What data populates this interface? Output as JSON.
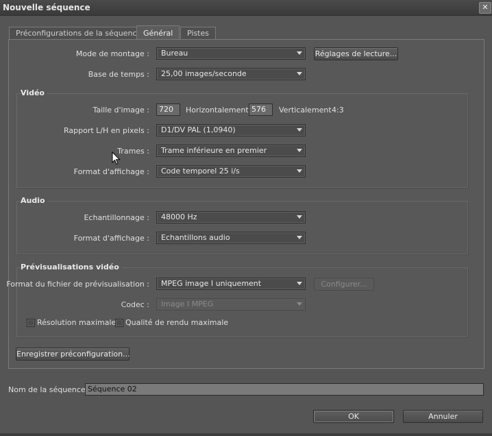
{
  "window": {
    "title": "Nouvelle séquence",
    "close_glyph": "✕"
  },
  "tabs": [
    {
      "label": "Préconfigurations de la séquence"
    },
    {
      "label": "Général"
    },
    {
      "label": "Pistes"
    }
  ],
  "general": {
    "mode_label": "Mode de montage :",
    "mode_value": "Bureau",
    "playback_button": "Réglages de lecture...",
    "timebase_label": "Base de temps :",
    "timebase_value": "25,00 images/seconde"
  },
  "video": {
    "title": "Vidéo",
    "frame_size_label": "Taille d'image :",
    "width": "720",
    "horizontal_label": "Horizontalement",
    "height": "576",
    "vertical_label": "Verticalement",
    "aspect": "4:3",
    "pixel_aspect_label": "Rapport L/H en pixels :",
    "pixel_aspect_value": "D1/DV PAL (1,0940)",
    "fields_label": "Trames :",
    "fields_value": "Trame inférieure en premier",
    "display_format_label": "Format d'affichage :",
    "display_format_value": "Code temporel 25 i/s"
  },
  "audio": {
    "title": "Audio",
    "sample_rate_label": "Echantillonnage :",
    "sample_rate_value": "48000 Hz",
    "display_format_label": "Format d'affichage :",
    "display_format_value": "Echantillons audio"
  },
  "previews": {
    "title": "Prévisualisations vidéo",
    "file_format_label": "Format du fichier de prévisualisation :",
    "file_format_value": "MPEG image I uniquement",
    "configure_button": "Configurer...",
    "codec_label": "Codec :",
    "codec_value": "Image I MPEG",
    "max_resolution_label": "Résolution maximale",
    "max_quality_label": "Qualité de rendu maximale"
  },
  "save_preset_button": "Enregistrer préconfiguration...",
  "sequence_name_label": "Nom de la séquence :",
  "sequence_name_value": "Séquence 02",
  "ok_button": "OK",
  "cancel_button": "Annuler"
}
